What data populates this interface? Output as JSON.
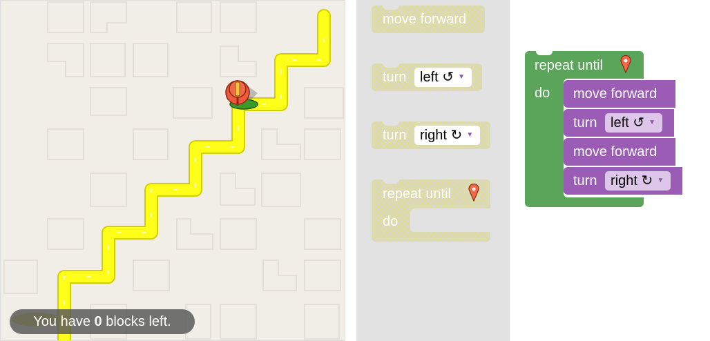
{
  "maze": {
    "status_prefix": "You have ",
    "status_count": "0",
    "status_suffix": " blocks left.",
    "path_color": "#ffff00",
    "marker_icon": "map-marker-icon",
    "pegman_icon": "pegman-icon"
  },
  "toolbox": {
    "move_forward": "move forward",
    "turn_left": {
      "label": "turn",
      "value": "left ↺"
    },
    "turn_right": {
      "label": "turn",
      "value": "right ↻"
    },
    "repeat_until": {
      "label": "repeat until",
      "do": "do"
    }
  },
  "workspace": {
    "repeat_label": "repeat until",
    "do_label": "do",
    "stack": [
      {
        "text": "move forward"
      },
      {
        "label": "turn",
        "value": "left ↺"
      },
      {
        "text": "move forward"
      },
      {
        "label": "turn",
        "value": "right ↻"
      }
    ]
  },
  "colors": {
    "motion": "#9a5cb5",
    "loop": "#5ba55b",
    "toolbox_bg": "#e2e2e2",
    "maze_bg": "#f1eee7"
  }
}
